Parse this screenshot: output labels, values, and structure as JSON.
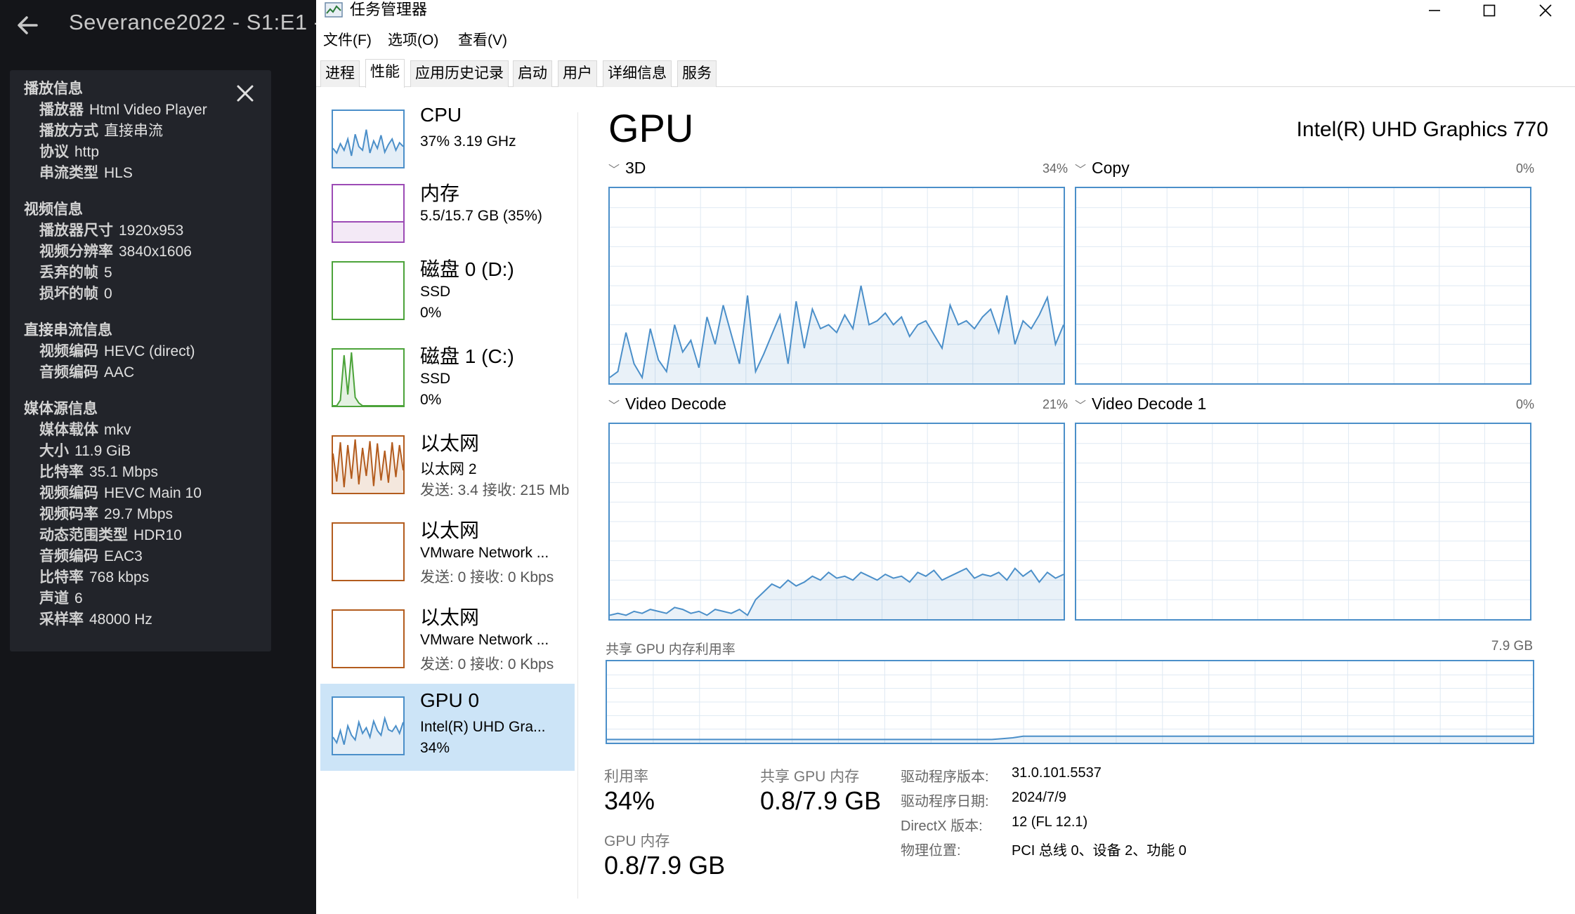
{
  "player": {
    "title": "Severance2022 - S1:E1 -",
    "sections": [
      {
        "heading": "播放信息",
        "rows": [
          {
            "k": "播放器",
            "v": "Html Video Player"
          },
          {
            "k": "播放方式",
            "v": "直接串流"
          },
          {
            "k": "协议",
            "v": "http"
          },
          {
            "k": "串流类型",
            "v": "HLS"
          }
        ]
      },
      {
        "heading": "视频信息",
        "rows": [
          {
            "k": "播放器尺寸",
            "v": "1920x953"
          },
          {
            "k": "视频分辨率",
            "v": "3840x1606"
          },
          {
            "k": "丢弃的帧",
            "v": "5"
          },
          {
            "k": "损坏的帧",
            "v": "0"
          }
        ]
      },
      {
        "heading": "直接串流信息",
        "rows": [
          {
            "k": "视频编码",
            "v": "HEVC (direct)"
          },
          {
            "k": "音频编码",
            "v": "AAC"
          }
        ]
      },
      {
        "heading": "媒体源信息",
        "rows": [
          {
            "k": "媒体载体",
            "v": "mkv"
          },
          {
            "k": "大小",
            "v": "11.9 GiB"
          },
          {
            "k": "比特率",
            "v": "35.1 Mbps"
          },
          {
            "k": "视频编码",
            "v": "HEVC Main 10"
          },
          {
            "k": "视频码率",
            "v": "29.7 Mbps"
          },
          {
            "k": "动态范围类型",
            "v": "HDR10"
          },
          {
            "k": "音频编码",
            "v": "EAC3"
          },
          {
            "k": "比特率",
            "v": "768 kbps"
          },
          {
            "k": "声道",
            "v": "6"
          },
          {
            "k": "采样率",
            "v": "48000 Hz"
          }
        ]
      }
    ]
  },
  "taskmanager": {
    "title": "任务管理器",
    "menu": [
      "文件(F)",
      "选项(O)",
      "查看(V)"
    ],
    "tabs": [
      "进程",
      "性能",
      "应用历史记录",
      "启动",
      "用户",
      "详细信息",
      "服务"
    ],
    "active_tab": "性能",
    "sidebar": [
      {
        "title": "CPU",
        "lines": [
          "37% 3.19 GHz"
        ],
        "color": "#4b8fc9"
      },
      {
        "title": "内存",
        "lines": [
          "5.5/15.7 GB (35%)"
        ],
        "color": "#9c4bb5"
      },
      {
        "title": "磁盘 0 (D:)",
        "lines": [
          "SSD",
          "0%"
        ],
        "color": "#4ca33a"
      },
      {
        "title": "磁盘 1 (C:)",
        "lines": [
          "SSD",
          "0%"
        ],
        "color": "#4ca33a"
      },
      {
        "title": "以太网",
        "lines": [
          "以太网 2",
          "发送: 3.4 接收: 215 Mb"
        ],
        "color": "#b35c1e"
      },
      {
        "title": "以太网",
        "lines": [
          "VMware Network ...",
          "发送: 0 接收: 0 Kbps"
        ],
        "color": "#b35c1e"
      },
      {
        "title": "以太网",
        "lines": [
          "VMware Network ...",
          "发送: 0 接收: 0 Kbps"
        ],
        "color": "#b35c1e"
      },
      {
        "title": "GPU 0",
        "lines": [
          "Intel(R) UHD Gra...",
          "34%"
        ],
        "color": "#4b8fc9"
      }
    ],
    "gpu": {
      "heading": "GPU",
      "name": "Intel(R) UHD Graphics 770",
      "engines": [
        {
          "label": "3D",
          "pct": "34%"
        },
        {
          "label": "Copy",
          "pct": "0%"
        },
        {
          "label": "Video Decode",
          "pct": "21%"
        },
        {
          "label": "Video Decode 1",
          "pct": "0%"
        }
      ],
      "shared_mem_label": "共享 GPU 内存利用率",
      "shared_mem_max": "7.9 GB",
      "utilization_label": "利用率",
      "utilization": "34%",
      "shared_mem_stat_label": "共享 GPU 内存",
      "shared_mem_stat": "0.8/7.9 GB",
      "gpu_mem_label": "GPU 内存",
      "gpu_mem": "0.8/7.9 GB",
      "details": [
        {
          "k": "驱动程序版本:",
          "v": "31.0.101.5537"
        },
        {
          "k": "驱动程序日期:",
          "v": "2024/7/9"
        },
        {
          "k": "DirectX 版本:",
          "v": "12 (FL 12.1)"
        },
        {
          "k": "物理位置:",
          "v": "PCI 总线 0、设备 2、功能 0"
        }
      ]
    },
    "series": {
      "3d": [
        3,
        6,
        26,
        10,
        3,
        28,
        12,
        6,
        30,
        16,
        22,
        8,
        34,
        20,
        40,
        25,
        10,
        45,
        6,
        15,
        25,
        35,
        10,
        42,
        18,
        38,
        28,
        30,
        26,
        35,
        28,
        50,
        30,
        32,
        36,
        30,
        34,
        24,
        30,
        32,
        25,
        18,
        40,
        30,
        32,
        28,
        34,
        38,
        26,
        45,
        20,
        32,
        28,
        35,
        44,
        20,
        30
      ],
      "video_decode": [
        2,
        3,
        2,
        4,
        3,
        5,
        4,
        3,
        6,
        5,
        3,
        4,
        2,
        5,
        4,
        3,
        5,
        2,
        10,
        14,
        18,
        16,
        20,
        17,
        19,
        22,
        20,
        24,
        21,
        22,
        20,
        24,
        22,
        20,
        23,
        21,
        22,
        19,
        24,
        22,
        25,
        20,
        22,
        24,
        26,
        21,
        23,
        22,
        24,
        20,
        26,
        22,
        25,
        19,
        24,
        21,
        23
      ],
      "shared_mem": [
        4,
        4,
        4,
        4,
        4,
        4,
        4,
        4,
        4,
        4,
        4,
        4,
        4,
        4,
        4,
        4,
        4,
        4,
        4,
        4,
        4,
        4,
        4,
        4,
        4,
        4,
        4,
        4,
        4,
        4,
        4,
        4,
        4,
        4,
        4,
        4,
        4,
        4,
        5,
        6,
        8,
        8,
        8,
        8,
        8,
        8,
        8,
        8,
        8,
        8,
        8,
        8,
        8,
        8,
        8,
        8,
        8,
        8,
        8,
        8,
        8,
        8,
        8,
        8,
        8,
        8,
        8,
        8,
        8,
        8,
        8,
        8,
        8,
        8,
        8,
        8,
        8,
        8,
        8,
        8,
        8,
        8,
        8,
        8,
        8,
        8,
        8,
        8,
        8,
        8
      ],
      "cpu_thumb": [
        20,
        15,
        25,
        18,
        30,
        12,
        35,
        22,
        18,
        40,
        15,
        28,
        20,
        34,
        16,
        24,
        30,
        18,
        26,
        22
      ],
      "mem_thumb": [
        35,
        35,
        35,
        35,
        35,
        35,
        35,
        35,
        35,
        35,
        35,
        35,
        35,
        35,
        35,
        35,
        35,
        35,
        35,
        35
      ],
      "disk1_thumb": [
        0,
        0,
        10,
        90,
        20,
        95,
        15,
        5,
        0,
        0,
        0,
        0,
        0,
        0,
        0,
        0,
        0,
        0,
        0,
        0
      ],
      "eth_thumb": [
        70,
        20,
        90,
        10,
        85,
        25,
        95,
        15,
        80,
        30,
        92,
        12,
        88,
        22,
        75,
        18,
        90,
        28,
        85,
        40
      ],
      "gpu_thumb": [
        18,
        12,
        25,
        10,
        30,
        20,
        15,
        34,
        22,
        28,
        18,
        35,
        25,
        20,
        38,
        26,
        24,
        30,
        22,
        34
      ]
    }
  }
}
